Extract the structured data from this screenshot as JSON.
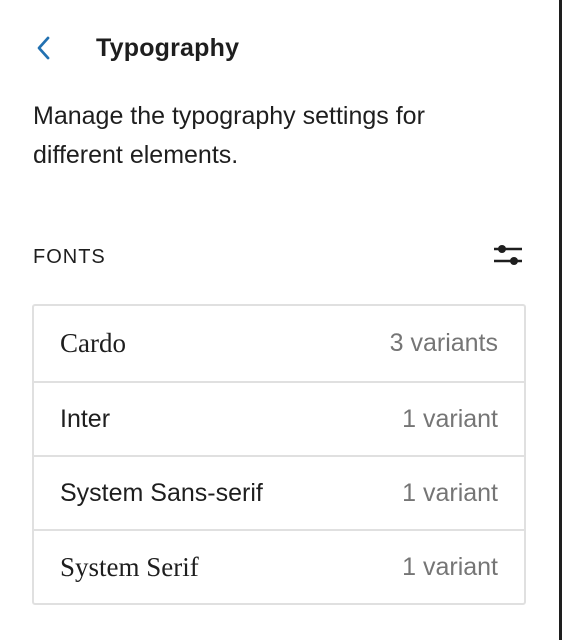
{
  "header": {
    "back_icon": "chevron-left-icon",
    "title": "Typography"
  },
  "description": "Manage the typography settings for different elements.",
  "fonts_section": {
    "title": "FONTS",
    "options_icon": "sliders-icon",
    "items": [
      {
        "name": "Cardo",
        "variants": "3 variants",
        "style": "serif"
      },
      {
        "name": "Inter",
        "variants": "1 variant",
        "style": "sans"
      },
      {
        "name": "System Sans-serif",
        "variants": "1 variant",
        "style": "sans"
      },
      {
        "name": "System Serif",
        "variants": "1 variant",
        "style": "serif"
      }
    ]
  },
  "colors": {
    "accent": "#3858e9",
    "text": "#1e1e1e",
    "muted": "#757575",
    "border": "#e0e0e0"
  }
}
